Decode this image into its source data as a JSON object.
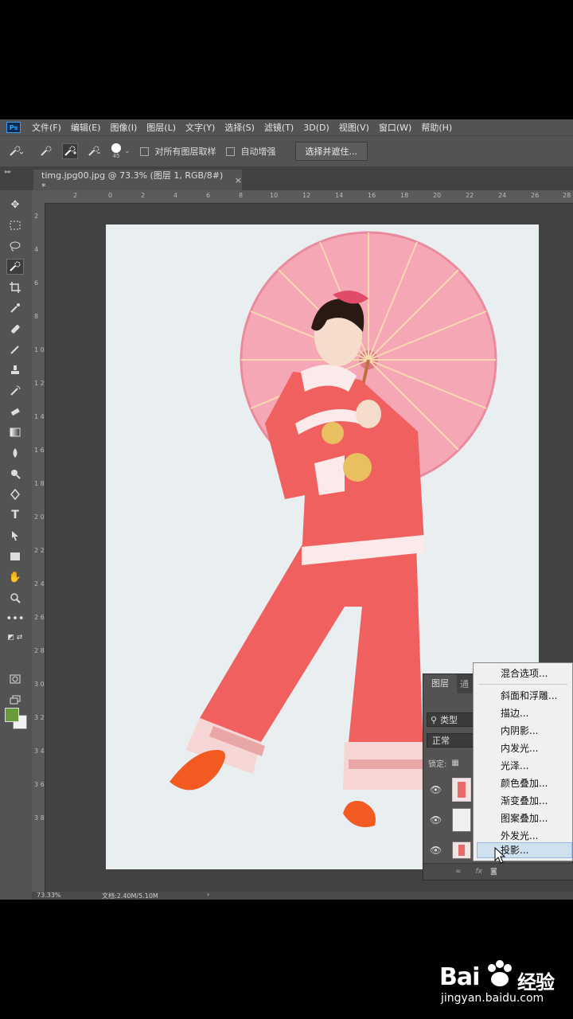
{
  "app": {
    "logo": "Ps"
  },
  "menu": [
    "文件(F)",
    "编辑(E)",
    "图像(I)",
    "图层(L)",
    "文字(Y)",
    "选择(S)",
    "滤镜(T)",
    "3D(D)",
    "视图(V)",
    "窗口(W)",
    "帮助(H)"
  ],
  "options": {
    "brush_size": "45",
    "sample_all_layers": "对所有图层取样",
    "auto_enhance": "自动增强",
    "select_mask_button": "选择并遮住..."
  },
  "document": {
    "tab_title": "timg.jpg00.jpg @ 73.3% (图层 1, RGB/8#) *",
    "close": "×"
  },
  "ruler_top": [
    "2",
    "0",
    "2",
    "4",
    "6",
    "8",
    "10",
    "12",
    "14",
    "16",
    "18",
    "20",
    "22",
    "24",
    "26",
    "28"
  ],
  "ruler_left": [
    "2",
    "4",
    "6",
    "8",
    "1 0",
    "1 2",
    "1 4",
    "1 6",
    "1 8",
    "2 0",
    "2 2",
    "2 4",
    "2 6",
    "2 8",
    "3 0",
    "3 2",
    "3 4",
    "3 6",
    "3 8"
  ],
  "status": {
    "zoom": "73.33%",
    "doc_size": "文档:2.40M/5.10M"
  },
  "layers_panel": {
    "tab": "图层",
    "tab2": "通",
    "search_label": "类型",
    "blend_mode": "正常",
    "lock_label": "锁定:"
  },
  "fx_menu": {
    "items": [
      "混合选项...",
      "斜面和浮雕...",
      "描边...",
      "内阴影...",
      "内发光...",
      "光泽...",
      "颜色叠加...",
      "渐变叠加...",
      "图案叠加...",
      "外发光...",
      "投影..."
    ],
    "highlighted": "投影..."
  },
  "watermark": {
    "brand": "Bai",
    "brand2": "经验",
    "url": "jingyan.baidu.com"
  },
  "colors": {
    "foreground": "#6a9b3a",
    "background": "#f2f2f2",
    "canvas": "#e9eff0"
  }
}
